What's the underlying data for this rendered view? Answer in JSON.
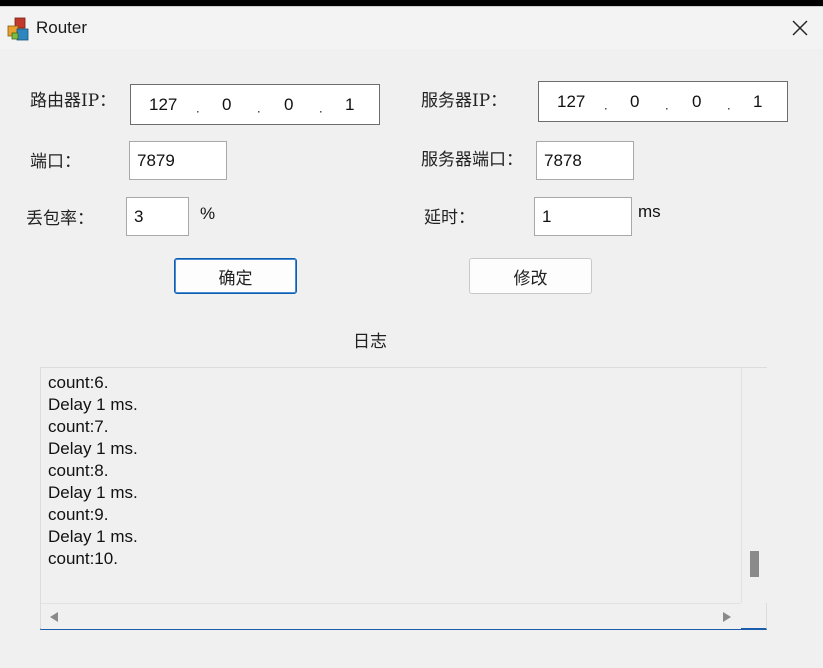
{
  "window": {
    "title": "Router",
    "app_icon": "router-app-icon",
    "close_icon": "close-icon"
  },
  "form": {
    "router_ip_label": "路由器IP：",
    "router_ip": [
      "127",
      "0",
      "0",
      "1"
    ],
    "server_ip_label": "服务器IP：",
    "server_ip": [
      "127",
      "0",
      "0",
      "1"
    ],
    "ip_separator": ".",
    "port_label": "端口：",
    "port_value": "7879",
    "server_port_label": "服务器端口：",
    "server_port_value": "7878",
    "loss_label": "丢包率：",
    "loss_value": "3",
    "loss_unit": "%",
    "delay_label": "延时：",
    "delay_value": "1",
    "delay_unit": "ms"
  },
  "buttons": {
    "confirm": "确定",
    "modify": "修改"
  },
  "log": {
    "title": "日志",
    "lines": [
      "count:6.",
      "Delay 1 ms.",
      "count:7.",
      "Delay 1 ms.",
      "count:8.",
      "Delay 1 ms.",
      "count:9.",
      "Delay 1 ms.",
      "count:10."
    ]
  },
  "colors": {
    "accent": "#0a5fb4",
    "window_bg": "#f0f0f0"
  }
}
